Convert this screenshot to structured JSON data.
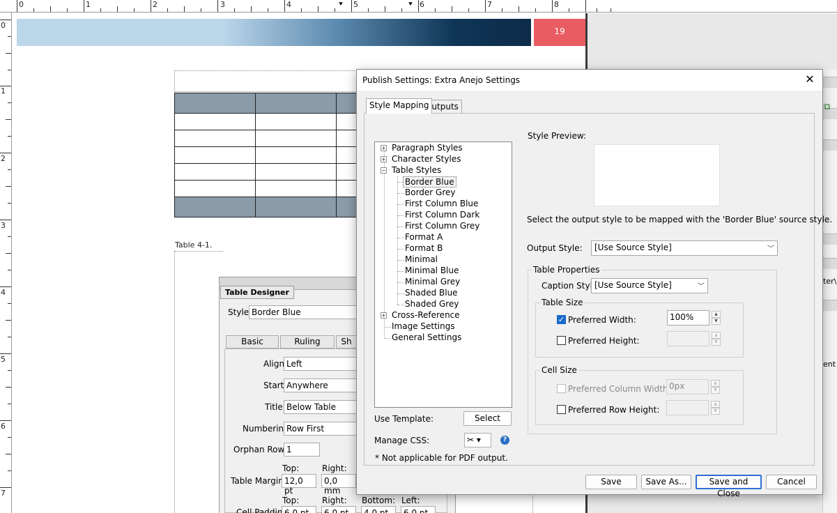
{
  "ruler": {
    "top_numbers": [
      "0",
      "1",
      "2",
      "3",
      "4",
      "5",
      "6",
      "7",
      "8"
    ],
    "left_numbers": [
      "0",
      "1",
      "2",
      "3",
      "4",
      "5",
      "6",
      "7"
    ]
  },
  "document": {
    "page_number": "19",
    "table_caption": "Table 4-1.",
    "banner_colors": [
      "#bcd6ea",
      "#0d2c4a"
    ],
    "badge_color": "#e85c62",
    "header_row_color": "#8b9ba8"
  },
  "table_designer": {
    "title": "Table Designer",
    "style_label": "Style:",
    "style_value": "Border Blue",
    "tabs": [
      "Basic",
      "Ruling",
      "Sh"
    ],
    "align_label": "Align:",
    "align_value": "Left",
    "start_label": "Start:",
    "start_value": "Anywhere",
    "title_label": "Title:",
    "title_value": "Below Table",
    "numbering_label": "Numbering:",
    "numbering_value": "Row First",
    "orphan_label": "Orphan Rows:",
    "orphan_value": "1",
    "margins_top_label": "Top:",
    "margins_right_label": "Right:",
    "margins_label": "Table Margins:",
    "margins_top_value": "12,0 pt",
    "margins_right_value": "0,0 mm",
    "padding_top_label": "Top:",
    "padding_right_label": "Right:",
    "padding_bottom_label": "Bottom:",
    "padding_left_label": "Left:",
    "padding_label": "Cell Padding:",
    "padding_top_value": "6,0 pt",
    "padding_right_value": "6,0 pt",
    "padding_bottom_value": "4,0 pt",
    "padding_left_value": "6,0 pt"
  },
  "dialog": {
    "title": "Publish Settings: Extra Anejo Settings",
    "close_glyph": "✕",
    "tabs": [
      "Style Mapping",
      "Outputs"
    ],
    "tree": {
      "paragraph_styles": "Paragraph Styles",
      "character_styles": "Character Styles",
      "table_styles": "Table Styles",
      "table_children": [
        "Border Blue",
        "Border Grey",
        "First Column Blue",
        "First Column Dark",
        "First Column Grey",
        "Format A",
        "Format B",
        "Minimal",
        "Minimal Blue",
        "Minimal Grey",
        "Shaded Blue",
        "Shaded Grey"
      ],
      "cross_reference": "Cross-Reference",
      "image_settings": "Image Settings",
      "general_settings": "General Settings"
    },
    "use_template_label": "Use Template:",
    "select_button": "Select",
    "manage_css_label": "Manage CSS:",
    "css_glyph": "✂ ▾",
    "help_glyph": "?",
    "footnote": "* Not applicable for PDF output.",
    "style_preview_label": "Style Preview:",
    "mapping_description": "Select the output style to be mapped with the 'Border Blue' source style.",
    "output_style_label": "Output Style:",
    "output_style_value": "[Use Source Style]",
    "table_properties_label": "Table Properties",
    "caption_style_label": "Caption Style:",
    "caption_style_value": "[Use Source Style]",
    "table_size_label": "Table Size",
    "preferred_width_label": "Preferred Width:",
    "preferred_width_checked": true,
    "preferred_width_value": "100%",
    "preferred_height_label": "Preferred Height:",
    "preferred_height_checked": false,
    "cell_size_label": "Cell Size",
    "preferred_column_width_label": "Preferred Column Width:",
    "preferred_column_width_value": "0px",
    "preferred_row_height_label": "Preferred Row Height:",
    "buttons": {
      "save": "Save",
      "save_as": "Save As...",
      "save_and_close": "Save and Close",
      "cancel": "Cancel"
    }
  },
  "right_panel": {
    "path_fragment": "ter\\F",
    "ent_fragment": "ent"
  }
}
